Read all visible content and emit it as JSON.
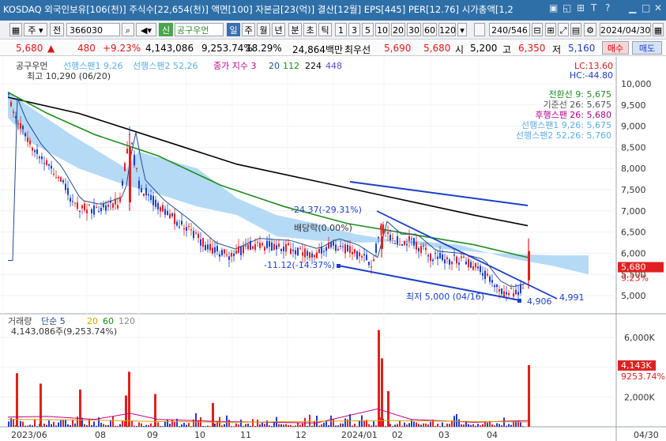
{
  "header": {
    "info": "KOSDAQ 외국인보유[106(천)] 주식수[22,654(천)] 액면[100] 자본금[23(억)] 결산[12월] EPS[445] PER[12.76] 시가총액[1,2",
    "title_icons": [
      "window-icon",
      "restore-icon",
      "pin-icon",
      "text-icon",
      "help-icon",
      "minimize-icon",
      "maximize-icon",
      "close-icon"
    ]
  },
  "toolbar": {
    "type_select": "주",
    "prev_label": "전",
    "code": "366030",
    "badge": "신",
    "name": "공구우먼",
    "periods": [
      "일",
      "주",
      "월",
      "년",
      "분",
      "초",
      "틱"
    ],
    "period_selected": "일",
    "intervals": [
      "1",
      "3",
      "5",
      "10",
      "20",
      "30",
      "60",
      "120"
    ],
    "range": "240/546",
    "date": "2024/04/30"
  },
  "price_bar": {
    "price": "5,680",
    "change": "480",
    "rate": "+9.23%",
    "volume": "4,143,086",
    "volume_ratio": "9,253.74%",
    "turnover": "18.29%",
    "amount": "24,864백만",
    "best_sell_label": "최우선",
    "best_sell": "5,690",
    "best_buy": "5,680",
    "open_label": "시",
    "open": "5,200",
    "high_label": "고",
    "high": "6,350",
    "low_label": "저",
    "low": "5,160",
    "buy_button": "매수",
    "sell_button": "매도"
  },
  "price_panel": {
    "legend_name": "공구우먼",
    "legend_items": [
      "선행스팬1 9,26",
      "선행스팬2 52,26",
      "종가 지수 3",
      "20",
      "112",
      "224",
      "448"
    ],
    "legend_colors": [
      "#5aaee8",
      "#5aaee8",
      "#c0008c",
      "#1e4d8c",
      "#1f8c1f",
      "#000000",
      "#5050c8"
    ],
    "high_note": "최고 10,290 (06/20)",
    "low_note": "최저 5,000 (04/16)",
    "lc": "LC:13.60",
    "hc": "HC:-44.80",
    "ichimoku": [
      {
        "label": "전환선 9: 5,675",
        "color": "#1a8c1a"
      },
      {
        "label": "기준선 26: 5,675",
        "color": "#555555"
      },
      {
        "label": "후행스팬 26: 5,680",
        "color": "#b0008c"
      },
      {
        "label": "선행스팬1 9,26: 5,675",
        "color": "#5aaee8"
      },
      {
        "label": "선행스팬2 52,26: 5,760",
        "color": "#5aaee8"
      }
    ],
    "annotations": [
      "-24.37(-29.31%)",
      "배당락(0.00%)",
      "-11.12(-14.37%)",
      "4,906",
      "4,991"
    ],
    "current_label": "5,680",
    "current_rate": "9.23%",
    "y_ticks": [
      "10,000",
      "9,500",
      "9,000",
      "8,500",
      "8,000",
      "7,500",
      "7,000",
      "6,500",
      "6,000",
      "5,500",
      "5,000"
    ]
  },
  "volume_panel": {
    "title": "거래량",
    "legend_items": [
      "단순 5",
      "20",
      "60",
      "120"
    ],
    "legend_colors": [
      "#1e4d8c",
      "#d8a000",
      "#1a8c1a",
      "#888888"
    ],
    "value": "4,143,086주(9,253.74%)",
    "y_ticks": [
      "6,000K",
      "4,000K",
      "2,000K"
    ],
    "current_label": "4,143K",
    "current_rate": "9253.74%"
  },
  "x_axis": [
    "2023/06",
    "08",
    "09",
    "10",
    "11",
    "12",
    "2024/01",
    "02",
    "03",
    "04",
    "04/30"
  ],
  "colors": {
    "up": "#e02020",
    "down": "#1c3fc8",
    "cloud": "#a8d4f5",
    "ma20": "#1e4d8c",
    "ma112": "#1f8c1f",
    "ma224": "#000000"
  }
}
